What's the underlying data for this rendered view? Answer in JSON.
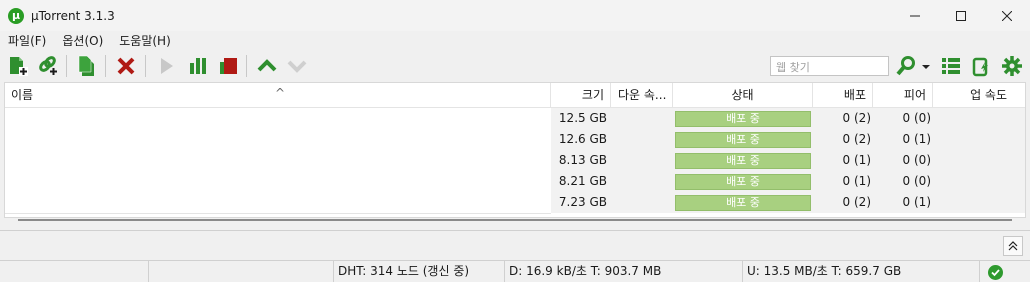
{
  "window": {
    "title": "µTorrent 3.1.3"
  },
  "menu": {
    "items": [
      "파일(F)",
      "옵션(O)",
      "도움말(H)"
    ]
  },
  "toolbar": {
    "search_placeholder": "웹 찾기"
  },
  "columns": {
    "name": "이름",
    "size": "크기",
    "down_speed": "다운 속...",
    "status": "상태",
    "seeds": "배포",
    "peers": "피어",
    "up_speed": "업 속도"
  },
  "torrents": [
    {
      "size": "12.5 GB",
      "status": "배포 중",
      "seeds": "0 (2)",
      "peers": "0 (0)"
    },
    {
      "size": "12.6 GB",
      "status": "배포 중",
      "seeds": "0 (2)",
      "peers": "0 (1)"
    },
    {
      "size": "8.13 GB",
      "status": "배포 중",
      "seeds": "0 (1)",
      "peers": "0 (0)"
    },
    {
      "size": "8.21 GB",
      "status": "배포 중",
      "seeds": "0 (1)",
      "peers": "0 (0)"
    },
    {
      "size": "7.23 GB",
      "status": "배포 중",
      "seeds": "0 (2)",
      "peers": "0 (1)"
    }
  ],
  "statusbar": {
    "dht": "DHT: 314 노드  (갱신 중)",
    "download": "D: 16.9 kB/초 T: 903.7 MB",
    "upload": "U: 13.5 MB/초 T: 659.7 GB"
  },
  "colors": {
    "accent_green": "#2a9d24",
    "status_seeding": "#a8d080",
    "stop_red": "#b01a14"
  }
}
